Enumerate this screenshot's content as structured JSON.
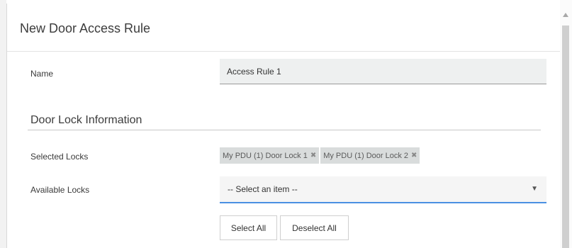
{
  "dialog": {
    "title": "New Door Access Rule"
  },
  "form": {
    "name_label": "Name",
    "name_value": "Access Rule 1",
    "section_title": "Door Lock Information",
    "selected_locks_label": "Selected Locks",
    "selected_locks": [
      {
        "label": "My PDU (1) Door Lock 1",
        "remove_icon": "close-icon",
        "remove_glyph": "✖"
      },
      {
        "label": "My PDU (1) Door Lock 2",
        "remove_icon": "close-icon",
        "remove_glyph": "✖"
      }
    ],
    "available_locks_label": "Available Locks",
    "available_locks_value": "-- Select an item --",
    "dropdown_arrow": "▼",
    "select_all_label": "Select All",
    "deselect_all_label": "Deselect All"
  },
  "colors": {
    "accent": "#4a90e2",
    "input_bg": "#eef0f0",
    "chip_bg": "#d9dcdc"
  }
}
